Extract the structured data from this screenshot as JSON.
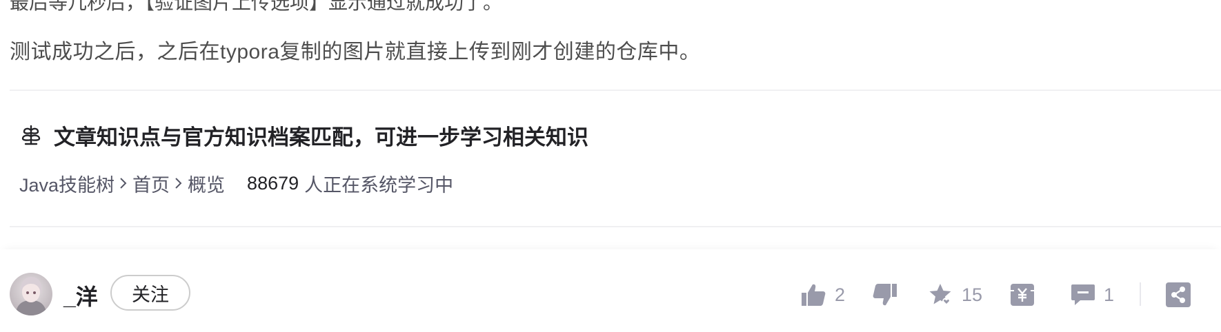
{
  "article": {
    "cut_line": "最后等几秒后，【验证图片上传选项】显示通过就成功了。",
    "paragraph": "测试成功之后，之后在typora复制的图片就直接上传到刚才创建的仓库中。"
  },
  "knowledge": {
    "title": "文章知识点与官方知识档案匹配，可进一步学习相关知识",
    "path": [
      "Java技能树",
      "首页",
      "概览"
    ],
    "learners_count": "88679",
    "learners_text": "人正在系统学习中"
  },
  "author": {
    "name": "_洋",
    "follow_label": "关注"
  },
  "actions": {
    "likes": "2",
    "collects": "15",
    "comments": "1"
  },
  "colors": {
    "icon_gray": "#999aaa",
    "text_dark": "#222226"
  }
}
